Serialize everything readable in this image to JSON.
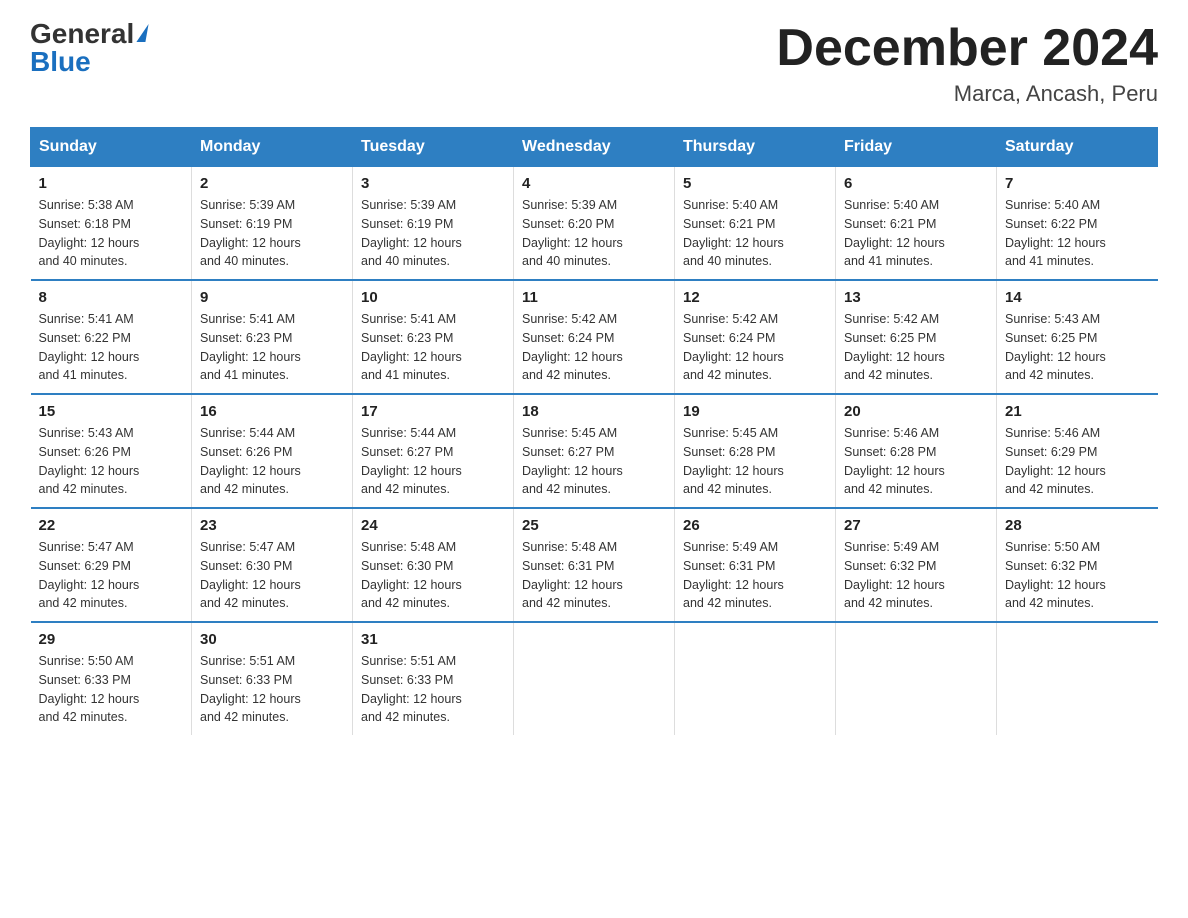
{
  "logo": {
    "general": "General",
    "blue": "Blue"
  },
  "title": "December 2024",
  "location": "Marca, Ancash, Peru",
  "days_of_week": [
    "Sunday",
    "Monday",
    "Tuesday",
    "Wednesday",
    "Thursday",
    "Friday",
    "Saturday"
  ],
  "weeks": [
    [
      {
        "day": "1",
        "sunrise": "5:38 AM",
        "sunset": "6:18 PM",
        "daylight": "12 hours and 40 minutes."
      },
      {
        "day": "2",
        "sunrise": "5:39 AM",
        "sunset": "6:19 PM",
        "daylight": "12 hours and 40 minutes."
      },
      {
        "day": "3",
        "sunrise": "5:39 AM",
        "sunset": "6:19 PM",
        "daylight": "12 hours and 40 minutes."
      },
      {
        "day": "4",
        "sunrise": "5:39 AM",
        "sunset": "6:20 PM",
        "daylight": "12 hours and 40 minutes."
      },
      {
        "day": "5",
        "sunrise": "5:40 AM",
        "sunset": "6:21 PM",
        "daylight": "12 hours and 40 minutes."
      },
      {
        "day": "6",
        "sunrise": "5:40 AM",
        "sunset": "6:21 PM",
        "daylight": "12 hours and 41 minutes."
      },
      {
        "day": "7",
        "sunrise": "5:40 AM",
        "sunset": "6:22 PM",
        "daylight": "12 hours and 41 minutes."
      }
    ],
    [
      {
        "day": "8",
        "sunrise": "5:41 AM",
        "sunset": "6:22 PM",
        "daylight": "12 hours and 41 minutes."
      },
      {
        "day": "9",
        "sunrise": "5:41 AM",
        "sunset": "6:23 PM",
        "daylight": "12 hours and 41 minutes."
      },
      {
        "day": "10",
        "sunrise": "5:41 AM",
        "sunset": "6:23 PM",
        "daylight": "12 hours and 41 minutes."
      },
      {
        "day": "11",
        "sunrise": "5:42 AM",
        "sunset": "6:24 PM",
        "daylight": "12 hours and 42 minutes."
      },
      {
        "day": "12",
        "sunrise": "5:42 AM",
        "sunset": "6:24 PM",
        "daylight": "12 hours and 42 minutes."
      },
      {
        "day": "13",
        "sunrise": "5:42 AM",
        "sunset": "6:25 PM",
        "daylight": "12 hours and 42 minutes."
      },
      {
        "day": "14",
        "sunrise": "5:43 AM",
        "sunset": "6:25 PM",
        "daylight": "12 hours and 42 minutes."
      }
    ],
    [
      {
        "day": "15",
        "sunrise": "5:43 AM",
        "sunset": "6:26 PM",
        "daylight": "12 hours and 42 minutes."
      },
      {
        "day": "16",
        "sunrise": "5:44 AM",
        "sunset": "6:26 PM",
        "daylight": "12 hours and 42 minutes."
      },
      {
        "day": "17",
        "sunrise": "5:44 AM",
        "sunset": "6:27 PM",
        "daylight": "12 hours and 42 minutes."
      },
      {
        "day": "18",
        "sunrise": "5:45 AM",
        "sunset": "6:27 PM",
        "daylight": "12 hours and 42 minutes."
      },
      {
        "day": "19",
        "sunrise": "5:45 AM",
        "sunset": "6:28 PM",
        "daylight": "12 hours and 42 minutes."
      },
      {
        "day": "20",
        "sunrise": "5:46 AM",
        "sunset": "6:28 PM",
        "daylight": "12 hours and 42 minutes."
      },
      {
        "day": "21",
        "sunrise": "5:46 AM",
        "sunset": "6:29 PM",
        "daylight": "12 hours and 42 minutes."
      }
    ],
    [
      {
        "day": "22",
        "sunrise": "5:47 AM",
        "sunset": "6:29 PM",
        "daylight": "12 hours and 42 minutes."
      },
      {
        "day": "23",
        "sunrise": "5:47 AM",
        "sunset": "6:30 PM",
        "daylight": "12 hours and 42 minutes."
      },
      {
        "day": "24",
        "sunrise": "5:48 AM",
        "sunset": "6:30 PM",
        "daylight": "12 hours and 42 minutes."
      },
      {
        "day": "25",
        "sunrise": "5:48 AM",
        "sunset": "6:31 PM",
        "daylight": "12 hours and 42 minutes."
      },
      {
        "day": "26",
        "sunrise": "5:49 AM",
        "sunset": "6:31 PM",
        "daylight": "12 hours and 42 minutes."
      },
      {
        "day": "27",
        "sunrise": "5:49 AM",
        "sunset": "6:32 PM",
        "daylight": "12 hours and 42 minutes."
      },
      {
        "day": "28",
        "sunrise": "5:50 AM",
        "sunset": "6:32 PM",
        "daylight": "12 hours and 42 minutes."
      }
    ],
    [
      {
        "day": "29",
        "sunrise": "5:50 AM",
        "sunset": "6:33 PM",
        "daylight": "12 hours and 42 minutes."
      },
      {
        "day": "30",
        "sunrise": "5:51 AM",
        "sunset": "6:33 PM",
        "daylight": "12 hours and 42 minutes."
      },
      {
        "day": "31",
        "sunrise": "5:51 AM",
        "sunset": "6:33 PM",
        "daylight": "12 hours and 42 minutes."
      },
      null,
      null,
      null,
      null
    ]
  ],
  "labels": {
    "sunrise": "Sunrise: ",
    "sunset": "Sunset: ",
    "daylight": "Daylight: "
  }
}
